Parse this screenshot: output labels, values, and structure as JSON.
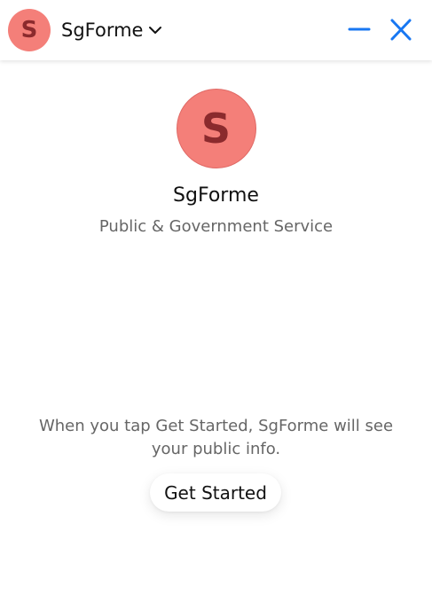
{
  "header": {
    "avatar_letter": "S",
    "title": "SgForme",
    "chevron_icon": "chevron-down-icon",
    "minimize_icon": "minus-icon",
    "close_icon": "close-icon",
    "accent_color": "#1877f2"
  },
  "profile": {
    "avatar_letter": "S",
    "avatar_color": "#f47f79",
    "name": "SgForme",
    "category": "Public & Government Service"
  },
  "footer": {
    "disclaimer": "When you tap Get Started, SgForme will see your public info.",
    "get_started_label": "Get Started"
  }
}
